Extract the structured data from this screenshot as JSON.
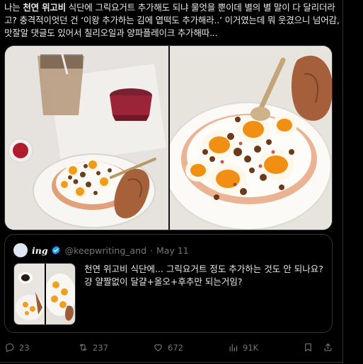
{
  "tweet": {
    "text_before_bold": "나는 ",
    "text_bold": "천연 위고비",
    "text_after_bold": " 식단에 그릭요거트 추가해도 되냐 물엇을 뿐이데 별의 별 말이 다 달리더라고? 충격적이엇던 건 ‘이왕 추가하는 김에 엽떡도 추가해라..’ 이거였는데 뭐 웃겼으니 넘어감, 맛잘알 댓글도 있어서 칠리오일과 양파플레이크 추가해따..."
  },
  "quote": {
    "name": "ing",
    "handle": "@keepwriting_and",
    "separator": "·",
    "date": "May 11",
    "text": "천연 위고비 식단에... 그릭요거트 정도 추가하는 것도 안 되나요? 걍 얄짤없이 달걀+올오+후추만 되는거임?"
  },
  "actions": {
    "replies": "23",
    "reposts": "237",
    "likes": "672",
    "views": "91K"
  },
  "icons": {
    "reply": "reply-icon",
    "repost": "repost-icon",
    "like": "heart-icon",
    "views": "views-icon",
    "bookmark": "bookmark-icon",
    "share": "share-icon",
    "verified": "verified-badge-icon"
  },
  "colors": {
    "background": "#000000",
    "text": "#e7e9ea",
    "muted": "#71767b",
    "border": "#2f3336",
    "verified": "#1d9bf0"
  }
}
